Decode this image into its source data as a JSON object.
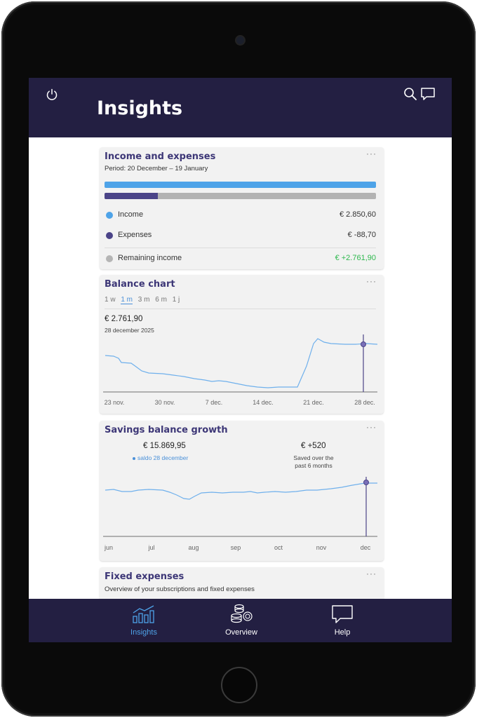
{
  "header": {
    "title": "Insights"
  },
  "income_card": {
    "title": "Income and expenses",
    "period": "Period: 20 December – 19 January",
    "income_fraction": 1.0,
    "expenses_fraction": 0.031,
    "rows": [
      {
        "label": "Income",
        "value": "€ 2.850,60",
        "color": "#4ea3e8"
      },
      {
        "label": "Expenses",
        "value": "€ -88,70",
        "color": "#4b4488"
      },
      {
        "label": "Remaining income",
        "value": "€ +2.761,90",
        "color": "#b5b5b5",
        "value_color": "#2db84d"
      }
    ]
  },
  "balance_card": {
    "title": "Balance chart",
    "ranges": [
      "1 w",
      "1 m",
      "3 m",
      "6 m",
      "1 j"
    ],
    "active_range": "1 m",
    "value": "€ 2.761,90",
    "date": "28 december 2025",
    "x_labels": [
      "23 nov.",
      "30 nov.",
      "7 dec.",
      "14 dec.",
      "21 dec.",
      "28 dec."
    ]
  },
  "savings_card": {
    "title": "Savings balance growth",
    "value": "€ 15.869,95",
    "value_caption": "saldo 28 december",
    "saved": "€ +520",
    "saved_caption_line1": "Saved over the",
    "saved_caption_line2": "past 6 months",
    "x_labels": [
      "jun",
      "jul",
      "aug",
      "sep",
      "oct",
      "nov",
      "dec"
    ]
  },
  "fixed_card": {
    "title": "Fixed expenses",
    "subtitle": "Overview of your subscriptions and fixed expenses"
  },
  "tabs": [
    {
      "label": "Insights",
      "icon": "bar-chart-icon",
      "active": true
    },
    {
      "label": "Overview",
      "icon": "coins-icon",
      "active": false
    },
    {
      "label": "Help",
      "icon": "chat-bubble-icon",
      "active": false
    }
  ],
  "colors": {
    "header": "#231f42",
    "accent": "#3d3777",
    "income": "#4ea3e8",
    "expenses": "#4b4488",
    "positive": "#2db84d",
    "line": "#6fb0ec"
  }
}
